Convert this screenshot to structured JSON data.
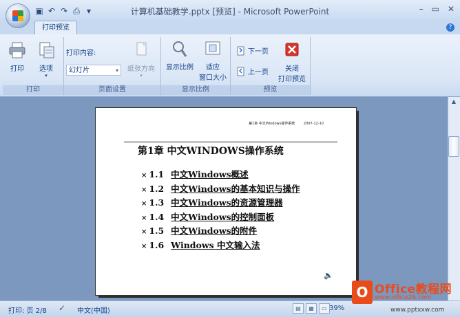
{
  "window": {
    "title": "计算机基础教学.pptx [预览] - Microsoft PowerPoint",
    "minimize": "–",
    "maximize": "▭",
    "close": "✕"
  },
  "qat": {
    "icons": [
      "save-icon",
      "undo-icon",
      "redo-icon",
      "print-icon",
      "customize-icon"
    ]
  },
  "tabs": [
    {
      "label": "打印预览",
      "active": true
    }
  ],
  "help": "?",
  "ribbon": {
    "print_group": {
      "label": "打印",
      "print_button": "打印",
      "options_button": "选项"
    },
    "page_setup_group": {
      "label": "页面设置",
      "print_what_label": "打印内容:",
      "print_what_value": "幻灯片",
      "orientation_button": "纸张方向"
    },
    "zoom_group": {
      "label": "显示比例",
      "zoom_button": "显示比例",
      "fit_window_line1": "适应",
      "fit_window_line2": "窗口大小"
    },
    "preview_group": {
      "label": "预览",
      "next_page": "下一页",
      "prev_page": "上一页",
      "close_line1": "关闭",
      "close_line2": "打印预览"
    }
  },
  "document": {
    "header": "第1章 中文Windows操作系统        2007-12-10",
    "chapter_title": "第1章 中文WINDOWS操作系统",
    "toc": [
      {
        "num": "1.1",
        "text": "中文Windows概述"
      },
      {
        "num": "1.2",
        "text": "中文Windows的基本知识与操作"
      },
      {
        "num": "1.3",
        "text": "中文Windows的资源管理器"
      },
      {
        "num": "1.4",
        "text": "中文Windows的控制面板"
      },
      {
        "num": "1.5",
        "text": "中文Windows的附件"
      },
      {
        "num": "1.6",
        "text": "Windows 中文输入法"
      }
    ],
    "bullet": "×"
  },
  "status": {
    "page": "打印: 页 2/8",
    "language": "中文(中国)",
    "zoom": "39%"
  },
  "watermark": {
    "logo_letter": "O",
    "title": "Office教程网",
    "url1": "www.office26.com",
    "url2": "www.pptxxw.com"
  },
  "colors": {
    "ribbon_text": "#15428b",
    "workspace": "#7c98bf",
    "watermark": "#e94b1b",
    "close_preview_icon": "#d9352b"
  }
}
